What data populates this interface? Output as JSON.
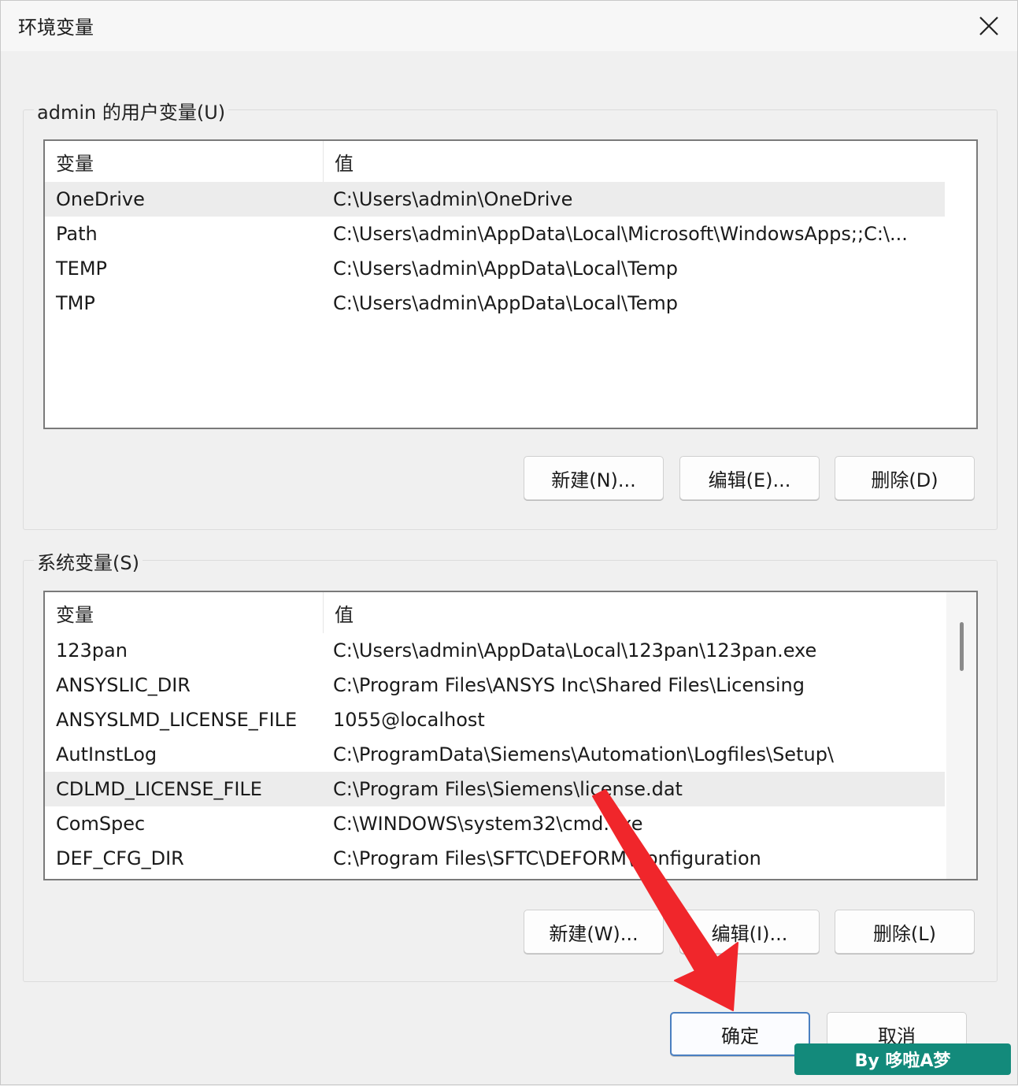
{
  "window": {
    "title": "环境变量"
  },
  "user_vars": {
    "legend": "admin 的用户变量(U)",
    "columns": {
      "variable": "变量",
      "value": "值"
    },
    "rows": [
      {
        "name": "OneDrive",
        "value": "C:\\Users\\admin\\OneDrive",
        "selected": true
      },
      {
        "name": "Path",
        "value": "C:\\Users\\admin\\AppData\\Local\\Microsoft\\WindowsApps;;C:\\...",
        "selected": false
      },
      {
        "name": "TEMP",
        "value": "C:\\Users\\admin\\AppData\\Local\\Temp",
        "selected": false
      },
      {
        "name": "TMP",
        "value": "C:\\Users\\admin\\AppData\\Local\\Temp",
        "selected": false
      }
    ],
    "buttons": {
      "new": "新建(N)...",
      "edit": "编辑(E)...",
      "delete": "删除(D)"
    }
  },
  "system_vars": {
    "legend": "系统变量(S)",
    "columns": {
      "variable": "变量",
      "value": "值"
    },
    "rows": [
      {
        "name": "123pan",
        "value": "C:\\Users\\admin\\AppData\\Local\\123pan\\123pan.exe",
        "selected": false
      },
      {
        "name": "ANSYSLIC_DIR",
        "value": "C:\\Program Files\\ANSYS Inc\\Shared Files\\Licensing",
        "selected": false
      },
      {
        "name": "ANSYSLMD_LICENSE_FILE",
        "value": "1055@localhost",
        "selected": false
      },
      {
        "name": "AutInstLog",
        "value": "C:\\ProgramData\\Siemens\\Automation\\Logfiles\\Setup\\",
        "selected": false
      },
      {
        "name": "CDLMD_LICENSE_FILE",
        "value": "C:\\Program Files\\Siemens\\license.dat",
        "selected": true
      },
      {
        "name": "ComSpec",
        "value": "C:\\WINDOWS\\system32\\cmd.exe",
        "selected": false
      },
      {
        "name": "DEF_CFG_DIR",
        "value": "C:\\Program Files\\SFTC\\DEFORM\\Configuration",
        "selected": false
      }
    ],
    "buttons": {
      "new": "新建(W)...",
      "edit": "编辑(I)...",
      "delete": "删除(L)"
    }
  },
  "footer": {
    "ok": "确定",
    "cancel": "取消"
  },
  "watermark": {
    "text": "By 哆啦A梦"
  },
  "colors": {
    "arrow": "#f0262b",
    "watermark_bg": "#138a7b",
    "primary_border": "#4a7fc1"
  },
  "icons": {
    "close": "close-icon",
    "arrow": "red-pointer-arrow-icon"
  }
}
